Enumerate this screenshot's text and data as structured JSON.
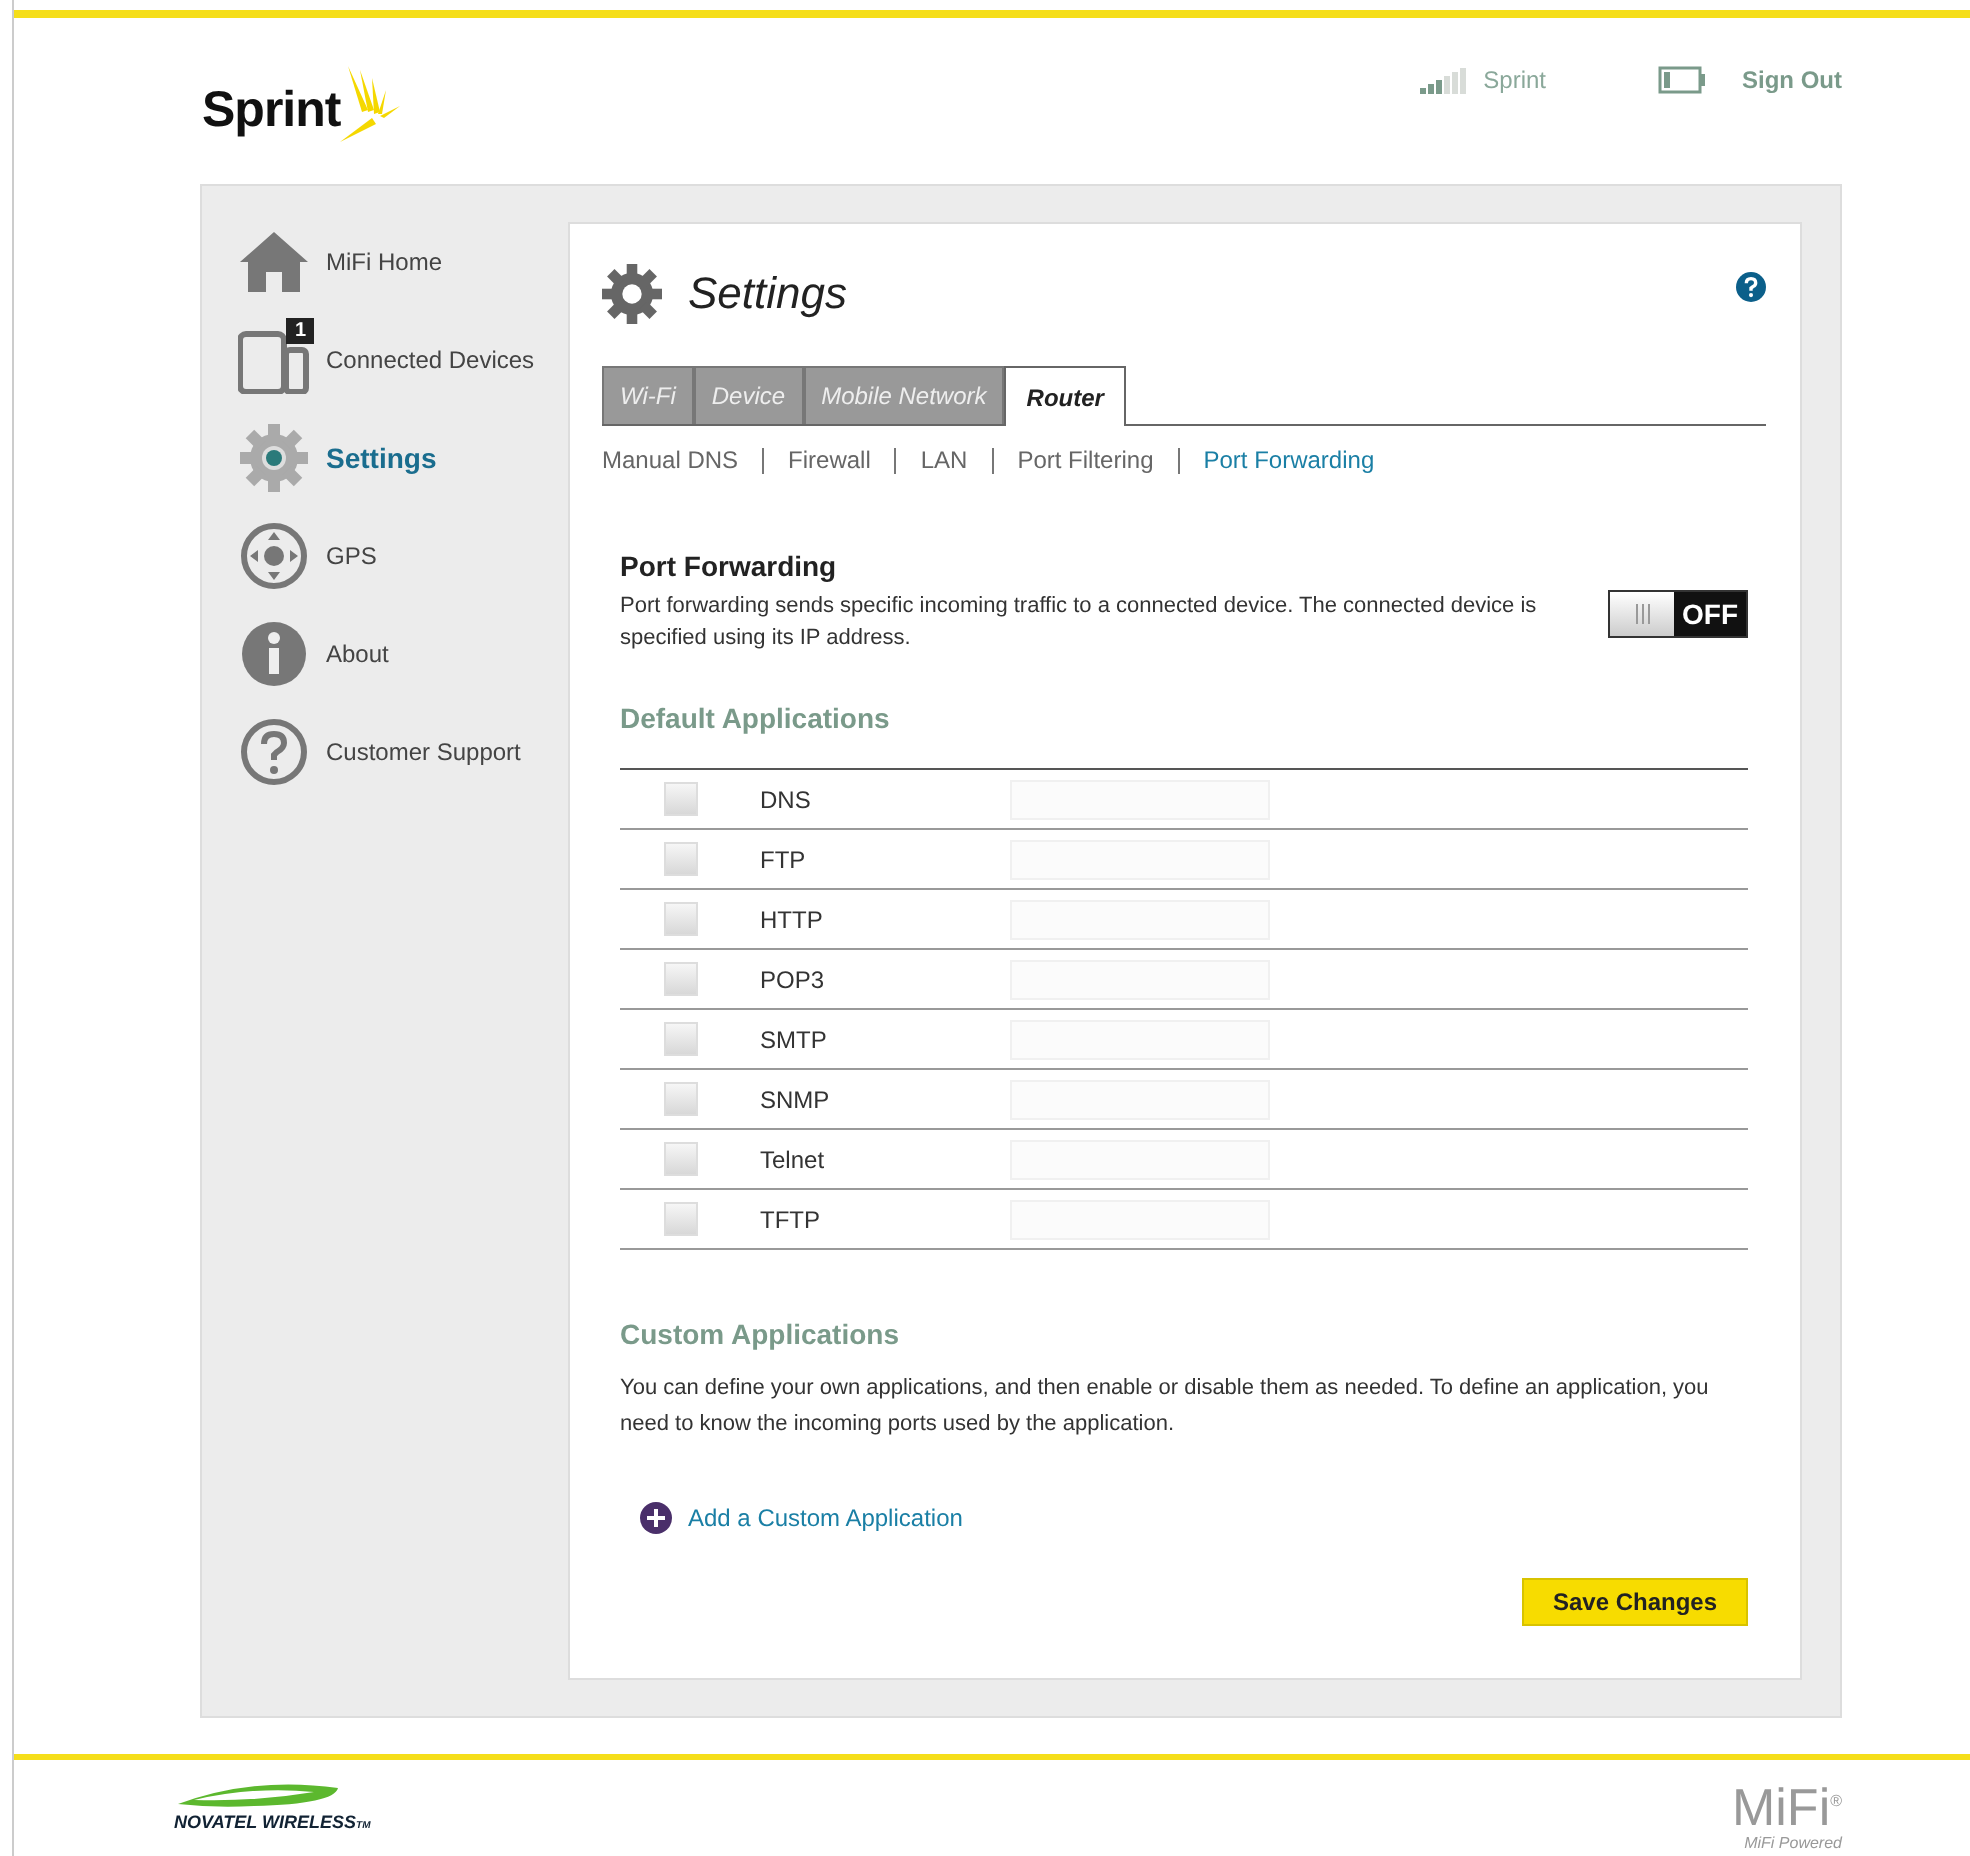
{
  "header": {
    "logo": "Sprint",
    "carrier": "Sprint",
    "sign_out": "Sign Out"
  },
  "sidebar": {
    "items": [
      {
        "label": "MiFi Home",
        "kind": "home",
        "selected": false
      },
      {
        "label": "Connected Devices",
        "kind": "devices",
        "selected": false,
        "badge": "1"
      },
      {
        "label": "Settings",
        "kind": "settings",
        "selected": true
      },
      {
        "label": "GPS",
        "kind": "gps",
        "selected": false
      },
      {
        "label": "About",
        "kind": "about",
        "selected": false
      },
      {
        "label": "Customer Support",
        "kind": "support",
        "selected": false
      }
    ]
  },
  "page": {
    "title": "Settings",
    "tabs": [
      {
        "label": "Wi-Fi",
        "selected": false
      },
      {
        "label": "Device",
        "selected": false
      },
      {
        "label": "Mobile Network",
        "selected": false
      },
      {
        "label": "Router",
        "selected": true
      }
    ],
    "subtabs": [
      {
        "label": "Manual DNS",
        "selected": false
      },
      {
        "label": "Firewall",
        "selected": false
      },
      {
        "label": "LAN",
        "selected": false
      },
      {
        "label": "Port Filtering",
        "selected": false
      },
      {
        "label": "Port Forwarding",
        "selected": true
      }
    ],
    "section_title": "Port Forwarding",
    "description": "Port forwarding sends specific incoming traffic to a connected device. The connected device is specified using its IP address.",
    "toggle": {
      "label": "OFF",
      "on": false
    },
    "default_apps_title": "Default Applications",
    "default_apps": [
      {
        "name": "DNS",
        "checked": false
      },
      {
        "name": "FTP",
        "checked": false
      },
      {
        "name": "HTTP",
        "checked": false
      },
      {
        "name": "POP3",
        "checked": false
      },
      {
        "name": "SMTP",
        "checked": false
      },
      {
        "name": "SNMP",
        "checked": false
      },
      {
        "name": "Telnet",
        "checked": false
      },
      {
        "name": "TFTP",
        "checked": false
      }
    ],
    "custom_apps_title": "Custom Applications",
    "custom_apps_text": "You can define your own applications, and then enable or disable them as needed. To define an application, you need to know the incoming ports used by the application.",
    "add_link": "Add a Custom Application",
    "save_button": "Save Changes"
  },
  "footer": {
    "left_logo": "NOVATEL WIRELESS",
    "left_tm": "TM",
    "right_logo": "MiFi",
    "right_reg": "®",
    "right_tagline": "MiFi Powered"
  }
}
